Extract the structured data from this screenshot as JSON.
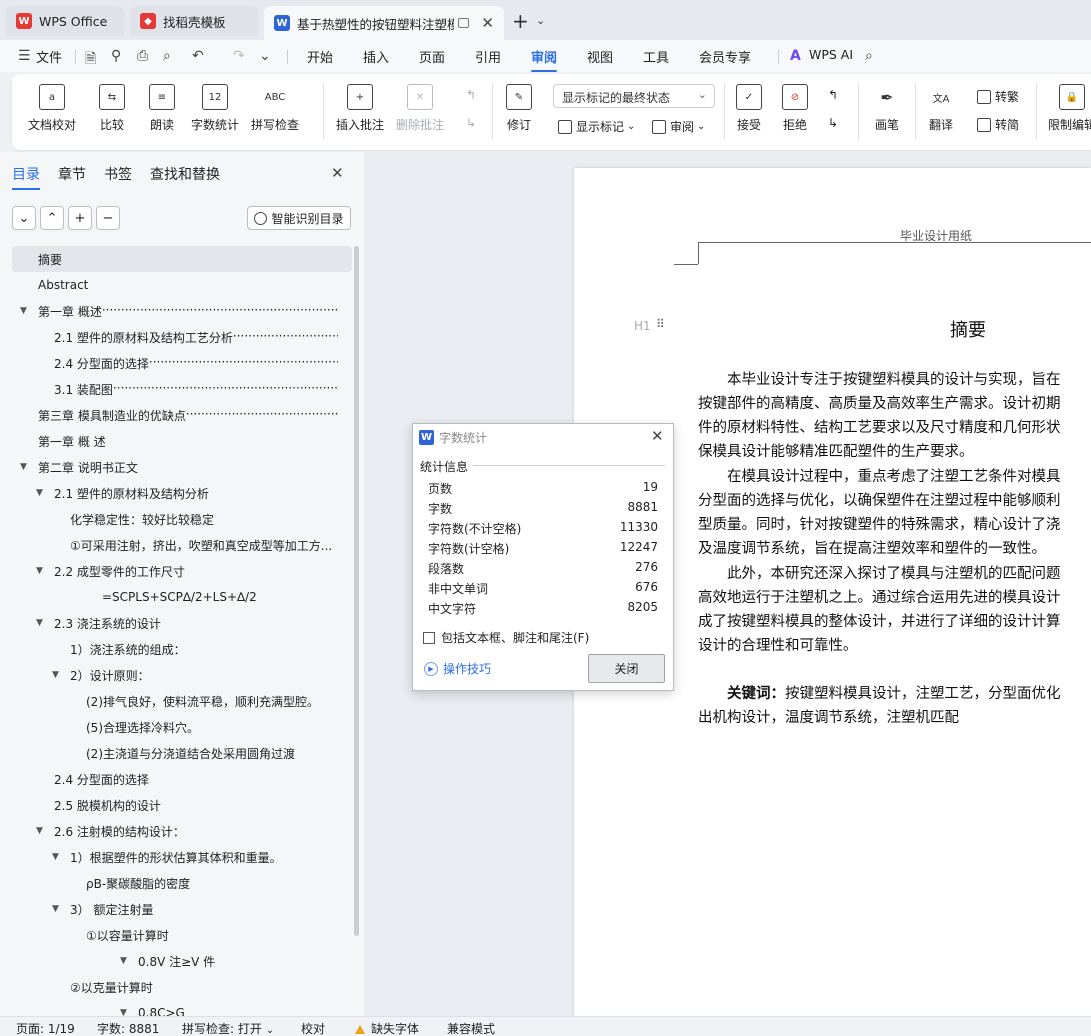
{
  "tabs": [
    {
      "label": "WPS Office",
      "icon": "wps-logo-icon",
      "color": "#e53935"
    },
    {
      "label": "找稻壳模板",
      "icon": "docer-icon",
      "color": "#e53935"
    },
    {
      "label": "基于热塑性的按钮塑料注塑模",
      "icon": "word-doc-icon",
      "color": "#2f64d8"
    }
  ],
  "menu": {
    "file": "文件",
    "items": [
      "开始",
      "插入",
      "页面",
      "引用",
      "审阅",
      "视图",
      "工具",
      "会员专享"
    ],
    "active": "审阅",
    "ai": "WPS AI"
  },
  "ribbon": {
    "doc_proof": "文档校对",
    "compare": "比较",
    "read_aloud": "朗读",
    "word_count": "字数统计",
    "spell_check": "拼写检查",
    "insert_comment": "插入批注",
    "delete_comment": "删除批注",
    "track_changes": "修订",
    "markup_state": "显示标记的最终状态",
    "show_markup": "显示标记",
    "review": "审阅",
    "accept": "接受",
    "reject": "拒绝",
    "ink": "画笔",
    "translate": "翻译",
    "to_traditional": "转繁",
    "to_simplified": "转简",
    "restrict_edit": "限制编辑"
  },
  "nav": {
    "tabs": [
      "目录",
      "章节",
      "书签",
      "查找和替换"
    ],
    "active_tab": "目录",
    "smart_toc": "智能识别目录",
    "toc": [
      {
        "text": "摘要",
        "indent": 0,
        "toggle": false,
        "selected": true,
        "dots": false
      },
      {
        "text": "Abstract",
        "indent": 0,
        "toggle": false,
        "dots": false
      },
      {
        "text": "第一章  概述",
        "indent": 0,
        "toggle": true,
        "dots": true
      },
      {
        "text": "2.1  塑件的原材料及结构工艺分析",
        "indent": 1,
        "toggle": false,
        "dots": true
      },
      {
        "text": "2.4  分型面的选择",
        "indent": 1,
        "toggle": false,
        "dots": true
      },
      {
        "text": "3.1   装配图",
        "indent": 1,
        "toggle": false,
        "dots": true
      },
      {
        "text": "第三章  模具制造业的优缺点",
        "indent": 0,
        "toggle": false,
        "dots": true
      },
      {
        "text": "第一章  概     述",
        "indent": 0,
        "toggle": false,
        "dots": false
      },
      {
        "text": "第二章  说明书正文",
        "indent": 0,
        "toggle": true,
        "dots": false
      },
      {
        "text": "2.1  塑件的原材料及结构分析",
        "indent": 1,
        "toggle": true,
        "dots": false
      },
      {
        "text": "化学稳定性：较好比较稳定",
        "indent": 2,
        "toggle": false,
        "dots": false
      },
      {
        "text": "①可采用注射，挤出，吹塑和真空成型等加工方...",
        "indent": 2,
        "toggle": false,
        "dots": false
      },
      {
        "text": "2.2  成型零件的工作尺寸",
        "indent": 1,
        "toggle": true,
        "dots": false
      },
      {
        "text": "=SCPLS+SCP∆/2+LS+∆/2",
        "indent": 4,
        "toggle": false,
        "dots": false
      },
      {
        "text": "2.3  浇注系统的设计",
        "indent": 1,
        "toggle": true,
        "dots": false
      },
      {
        "text": "1）浇注系统的组成：",
        "indent": 2,
        "toggle": false,
        "dots": false
      },
      {
        "text": "2）设计原则：",
        "indent": 2,
        "toggle": true,
        "dots": false
      },
      {
        "text": "(2)排气良好，使料流平稳，顺利充满型腔。",
        "indent": 3,
        "toggle": false,
        "dots": false
      },
      {
        "text": "(5)合理选择冷料穴。",
        "indent": 3,
        "toggle": false,
        "dots": false
      },
      {
        "text": "(2)主浇道与分浇道结合处采用圆角过渡",
        "indent": 3,
        "toggle": false,
        "dots": false
      },
      {
        "text": "2.4  分型面的选择",
        "indent": 1,
        "toggle": false,
        "dots": false
      },
      {
        "text": "2.5  脱模机构的设计",
        "indent": 1,
        "toggle": false,
        "dots": false
      },
      {
        "text": "2.6  注射模的结构设计：",
        "indent": 1,
        "toggle": true,
        "dots": false
      },
      {
        "text": "1）根据塑件的形状估算其体积和重量。",
        "indent": 2,
        "toggle": true,
        "dots": false
      },
      {
        "text": "ρB-聚碳酸脂的密度",
        "indent": 3,
        "toggle": false,
        "dots": false
      },
      {
        "text": "3）    额定注射量",
        "indent": 2,
        "toggle": true,
        "dots": false
      },
      {
        "text": "①以容量计算时",
        "indent": 3,
        "toggle": false,
        "dots": false
      },
      {
        "text": "0.8V 注≥V 件",
        "indent": 5,
        "toggle": true,
        "dots": false
      },
      {
        "text": "②以克量计算时",
        "indent": 2,
        "toggle": false,
        "dots": false
      },
      {
        "text": "0.8C>G",
        "indent": 5,
        "toggle": true,
        "dots": false
      }
    ]
  },
  "document": {
    "header": "毕业设计用纸",
    "heading_marker": "H1",
    "title": "摘要",
    "paragraphs": [
      [
        "　　本毕业设计专注于按键塑料模具的设计与实现，旨在",
        "按键部件的高精度、高质量及高效率生产需求。设计初期",
        "件的原材料特性、结构工艺要求以及尺寸精度和几何形状",
        "保模具设计能够精准匹配塑件的生产要求。"
      ],
      [
        "　　在模具设计过程中，重点考虑了注塑工艺条件对模具",
        "分型面的选择与优化，以确保塑件在注塑过程中能够顺利",
        "型质量。同时，针对按键塑件的特殊需求，精心设计了浇",
        "及温度调节系统，旨在提高注塑效率和塑件的一致性。"
      ],
      [
        "　　此外，本研究还深入探讨了模具与注塑机的匹配问题",
        "高效地运行于注塑机之上。通过综合运用先进的模具设计",
        "成了按键塑料模具的整体设计，并进行了详细的设计计算",
        "设计的合理性和可靠性。"
      ]
    ],
    "keywords_label": "　　关键词：",
    "keywords_line1": "按键塑料模具设计，注塑工艺，分型面优化",
    "keywords_line2": "出机构设计，温度调节系统，注塑机匹配"
  },
  "dialog": {
    "title": "字数统计",
    "section": "统计信息",
    "stats": [
      {
        "label": "页数",
        "value": "19"
      },
      {
        "label": "字数",
        "value": "8881"
      },
      {
        "label": "字符数(不计空格)",
        "value": "11330"
      },
      {
        "label": "字符数(计空格)",
        "value": "12247"
      },
      {
        "label": "段落数",
        "value": "276"
      },
      {
        "label": "非中文单词",
        "value": "676"
      },
      {
        "label": "中文字符",
        "value": "8205"
      }
    ],
    "include_label": "包括文本框、脚注和尾注(F)",
    "include_checked": false,
    "tips": "操作技巧",
    "close": "关闭"
  },
  "status": {
    "page": "页面: 1/19",
    "words": "字数: 8881",
    "spell": "拼写检查: 打开",
    "proof": "校对",
    "missing_font": "缺失字体",
    "compat": "兼容模式"
  },
  "colors": {
    "accent": "#2a6ee8",
    "warning": "#e8a317"
  }
}
